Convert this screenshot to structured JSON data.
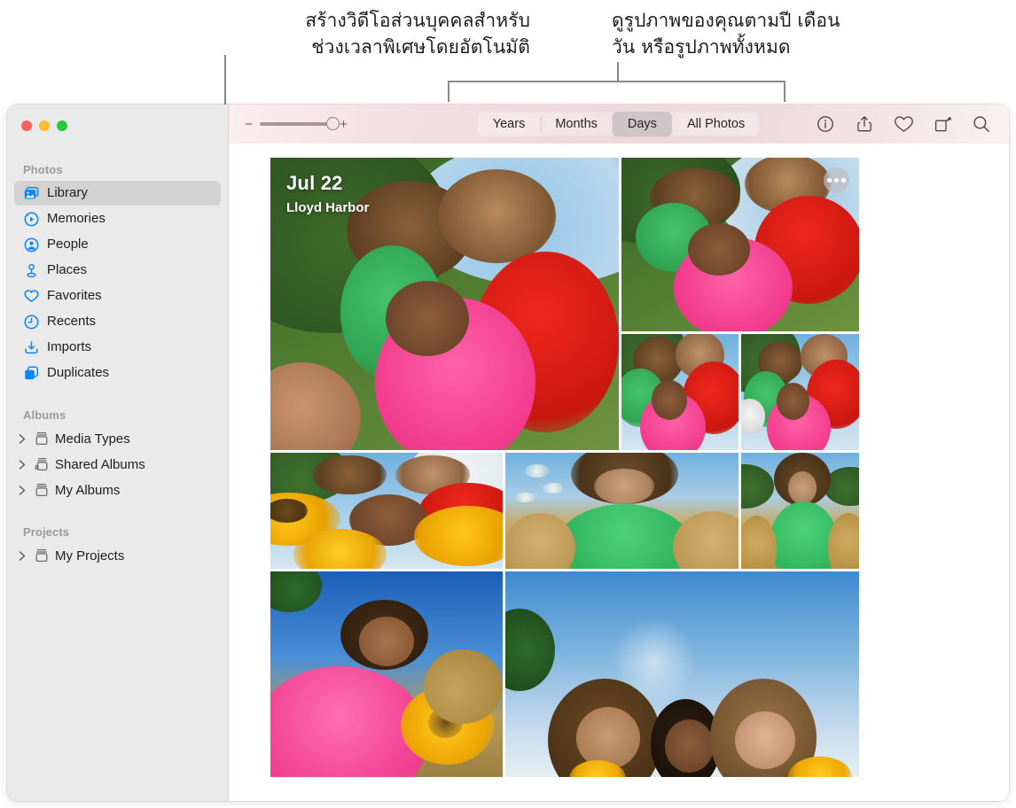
{
  "callouts": {
    "left": "สร้างวิดีโอส่วนบุคคลสำหรับ\nช่วงเวลาพิเศษโดยอัตโนมัติ",
    "right": "ดูรูปภาพของคุณตามปี เดือน\nวัน หรือรูปภาพทั้งหมด"
  },
  "window": {
    "traffic_lights": [
      "close",
      "minimize",
      "zoom"
    ]
  },
  "sidebar": {
    "sections": [
      {
        "title": "Photos",
        "items": [
          {
            "label": "Library",
            "icon": "photo-stack-icon",
            "selected": true
          },
          {
            "label": "Memories",
            "icon": "memories-icon",
            "selected": false
          },
          {
            "label": "People",
            "icon": "person-circle-icon",
            "selected": false
          },
          {
            "label": "Places",
            "icon": "map-pin-icon",
            "selected": false
          },
          {
            "label": "Favorites",
            "icon": "heart-icon",
            "selected": false
          },
          {
            "label": "Recents",
            "icon": "clock-icon",
            "selected": false
          },
          {
            "label": "Imports",
            "icon": "import-tray-icon",
            "selected": false
          },
          {
            "label": "Duplicates",
            "icon": "duplicate-icon",
            "selected": false
          }
        ]
      },
      {
        "title": "Albums",
        "items": [
          {
            "label": "Media Types",
            "icon": "album-icon",
            "disclosure": true
          },
          {
            "label": "Shared Albums",
            "icon": "shared-album-icon",
            "disclosure": true
          },
          {
            "label": "My Albums",
            "icon": "album-icon",
            "disclosure": true
          }
        ]
      },
      {
        "title": "Projects",
        "items": [
          {
            "label": "My Projects",
            "icon": "album-icon",
            "disclosure": true
          }
        ]
      }
    ]
  },
  "toolbar": {
    "zoom_out_label": "−",
    "zoom_in_label": "+",
    "zoom_value": 82,
    "segments": [
      {
        "label": "Years",
        "selected": false
      },
      {
        "label": "Months",
        "selected": false
      },
      {
        "label": "Days",
        "selected": true
      },
      {
        "label": "All Photos",
        "selected": false
      }
    ],
    "icons": [
      {
        "name": "info-icon",
        "title": "Info"
      },
      {
        "name": "share-icon",
        "title": "Share"
      },
      {
        "name": "heart-icon",
        "title": "Favorite"
      },
      {
        "name": "rotate-icon",
        "title": "Rotate"
      },
      {
        "name": "search-icon",
        "title": "Search"
      }
    ]
  },
  "main": {
    "day_group": {
      "date": "Jul 22",
      "place": "Lloyd Harbor",
      "more_button_label": "•••"
    }
  },
  "colors": {
    "accent_blue": "#0a84ff",
    "sidebar_bg": "#eaeaea",
    "selected_row": "#d2d2d2",
    "toolbar_pink": "#eed7dc",
    "traffic_red": "#ff5f57",
    "traffic_yellow": "#febc2e",
    "traffic_green": "#28c840"
  }
}
